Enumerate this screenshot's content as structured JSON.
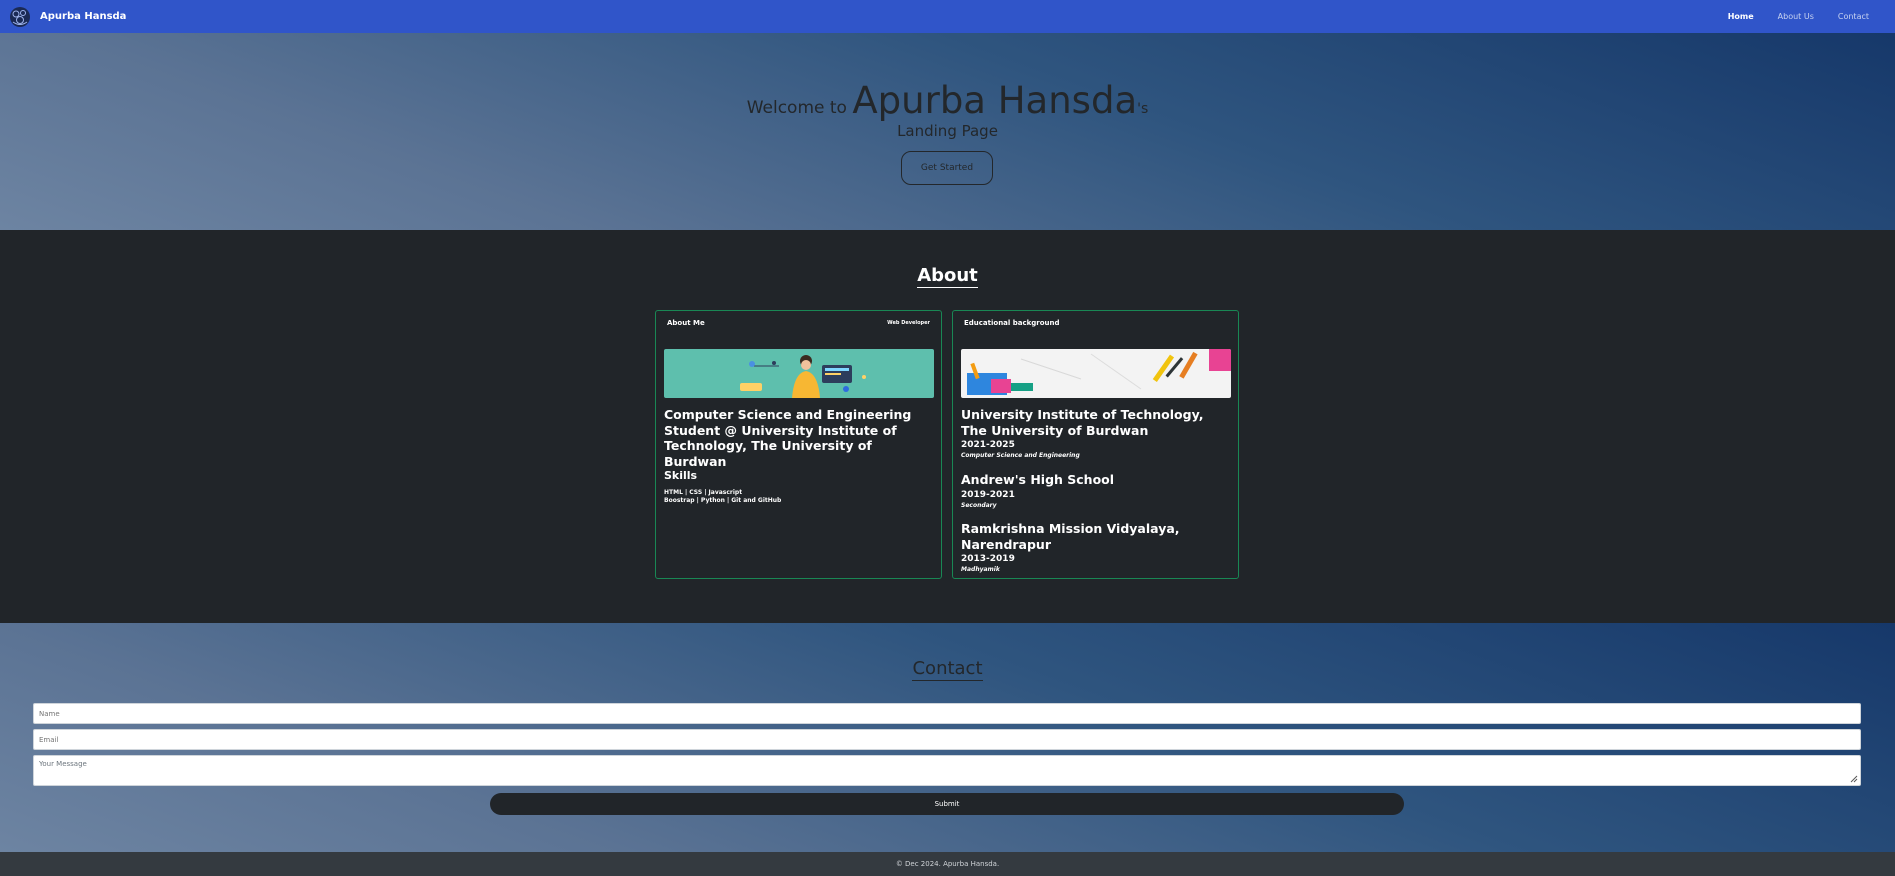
{
  "nav": {
    "brand": "Apurba Hansda",
    "links": [
      {
        "label": "Home",
        "active": true
      },
      {
        "label": "About Us",
        "active": false
      },
      {
        "label": "Contact",
        "active": false
      }
    ]
  },
  "hero": {
    "welcome": "Welcome to ",
    "name": "Apurba Hansda",
    "suffix": "'s",
    "subtitle": "Landing Page",
    "button": "Get Started"
  },
  "about": {
    "title": "About",
    "me_card": {
      "title": "About Me",
      "tag": "Web Developer",
      "headline": "Computer Science and Engineering Student @ University Institute of Technology, The University of Burdwan",
      "skills_title": "Skills",
      "skills_line1": "HTML | CSS | Javascript",
      "skills_line2": "Boostrap | Python | Git and GitHub"
    },
    "edu_card": {
      "title": "Educational background",
      "items": [
        {
          "name": "University Institute of Technology, The University of Burdwan",
          "years": "2021-2025",
          "course": "Computer Science and Engineering"
        },
        {
          "name": "Andrew's High School",
          "years": "2019-2021",
          "course": "Secondary"
        },
        {
          "name": "Ramkrishna Mission Vidyalaya, Narendrapur",
          "years": "2013-2019",
          "course": "Madhyamik"
        }
      ]
    }
  },
  "contact": {
    "title": "Contact",
    "name_placeholder": "Name",
    "email_placeholder": "Email",
    "message_placeholder": "Your Message",
    "submit": "Submit"
  },
  "footer": {
    "text": "© Dec 2024. Apurba Hansda."
  },
  "colors": {
    "navbar": "#3055c9",
    "dark": "#212529",
    "card_border": "#198754"
  }
}
